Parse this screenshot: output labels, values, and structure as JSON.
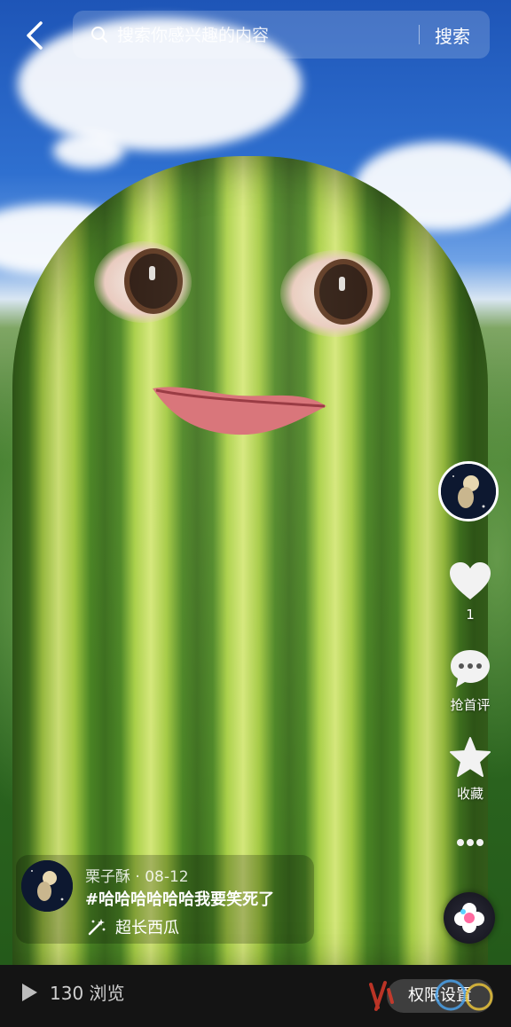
{
  "top_bar": {
    "search_placeholder": "搜索你感兴趣的内容",
    "search_button": "搜索"
  },
  "right_rail": {
    "like_count": "1",
    "comment_label": "抢首评",
    "favorite_label": "收藏"
  },
  "post": {
    "author": "栗子酥",
    "date": "08-12",
    "author_line": "栗子酥 · 08-12",
    "caption": "#哈哈哈哈哈哈我要笑死了",
    "effect_tag": "超长西瓜"
  },
  "bottom_bar": {
    "views": "130 浏览",
    "permission_button": "权限设置"
  },
  "colors": {
    "bottom_bar_bg": "#141414",
    "text_primary": "#ffffff"
  }
}
